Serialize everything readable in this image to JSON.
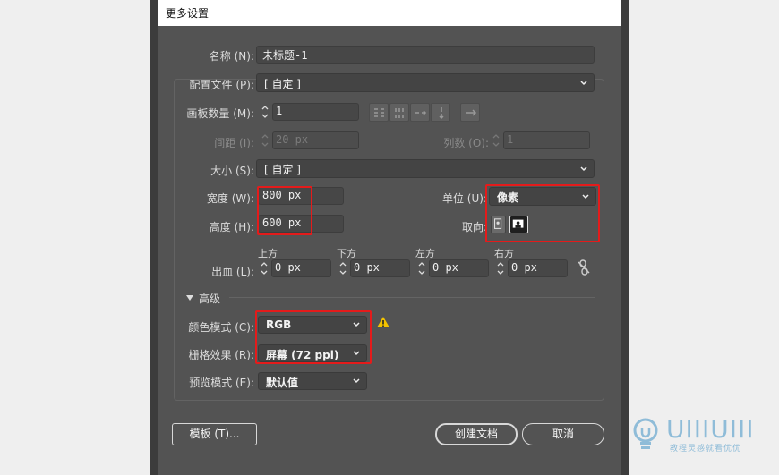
{
  "dialog": {
    "title": "更多设置"
  },
  "form": {
    "name_label": "名称 (N):",
    "name_value": "未标题-1",
    "profile_label": "配置文件 (P):",
    "profile_value": "[ 自定 ]",
    "artboards_label": "画板数量 (M):",
    "artboards_value": "1",
    "spacing_label": "间距 (I):",
    "spacing_value": "20 px",
    "columns_label": "列数 (O):",
    "columns_value": "1",
    "size_label": "大小 (S):",
    "size_value": "[ 自定 ]",
    "width_label": "宽度 (W):",
    "width_value": "800 px",
    "height_label": "高度 (H):",
    "height_value": "600 px",
    "units_label": "单位 (U):",
    "units_value": "像素",
    "orientation_label": "取向:",
    "bleed_label": "出血 (L):",
    "bleed": {
      "top_label": "上方",
      "top_value": "0 px",
      "bottom_label": "下方",
      "bottom_value": "0 px",
      "left_label": "左方",
      "left_value": "0 px",
      "right_label": "右方",
      "right_value": "0 px"
    },
    "advanced_label": "高级",
    "color_mode_label": "颜色模式 (C):",
    "color_mode_value": "RGB",
    "raster_label": "栅格效果 (R):",
    "raster_value": "屏幕 (72 ppi)",
    "preview_label": "预览模式 (E):",
    "preview_value": "默认值"
  },
  "buttons": {
    "template": "模板 (T)...",
    "create": "创建文档",
    "cancel": "取消"
  },
  "watermark": {
    "text": "UIIIUIII",
    "subtitle": "教程灵感就看优优"
  },
  "colors": {
    "highlight": "#e41b1b",
    "dialog_bg": "#535353",
    "warning": "#f2c200"
  }
}
